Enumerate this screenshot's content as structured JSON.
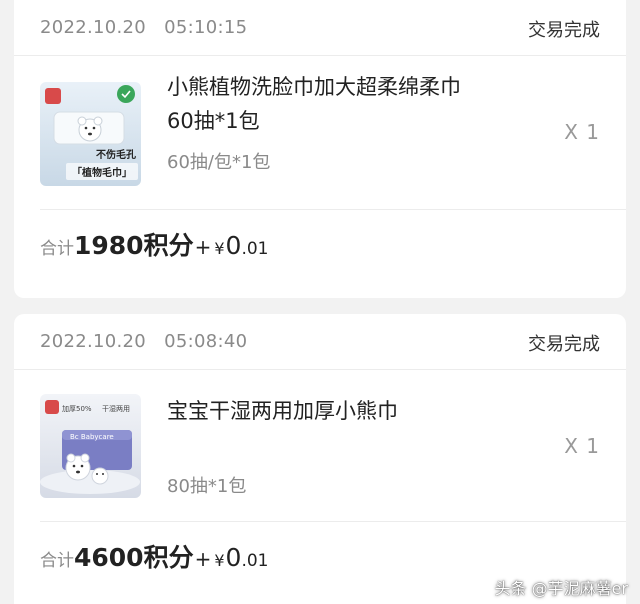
{
  "orders": [
    {
      "date": "2022.10.20",
      "time": "05:10:15",
      "status": "交易完成",
      "product": {
        "name": "小熊植物洗脸巾加大超柔绵柔巾60抽*1包",
        "spec": "60抽/包*1包",
        "qty": "X 1",
        "image_text": [
          "不伤毛孔",
          "「植物毛巾」"
        ]
      },
      "total": {
        "label": "合计",
        "points": "1980积分",
        "plus": "+",
        "yen": "¥",
        "int": "0",
        "dec": ".01"
      }
    },
    {
      "date": "2022.10.20",
      "time": "05:08:40",
      "status": "交易完成",
      "product": {
        "name": "宝宝干湿两用加厚小熊巾",
        "spec": "80抽*1包",
        "qty": "X 1",
        "image_text": [
          "加厚50%",
          "干湿两用",
          "Bc Babycare"
        ]
      },
      "total": {
        "label": "合计",
        "points": "4600积分",
        "plus": "+",
        "yen": "¥",
        "int": "0",
        "dec": ".01"
      }
    }
  ],
  "watermark": "头条 @芋泥麻薯er",
  "colors": {
    "brand_red": "#d84a4a",
    "eco_green": "#3aa65a",
    "text_gray": "#8a8a8a"
  }
}
